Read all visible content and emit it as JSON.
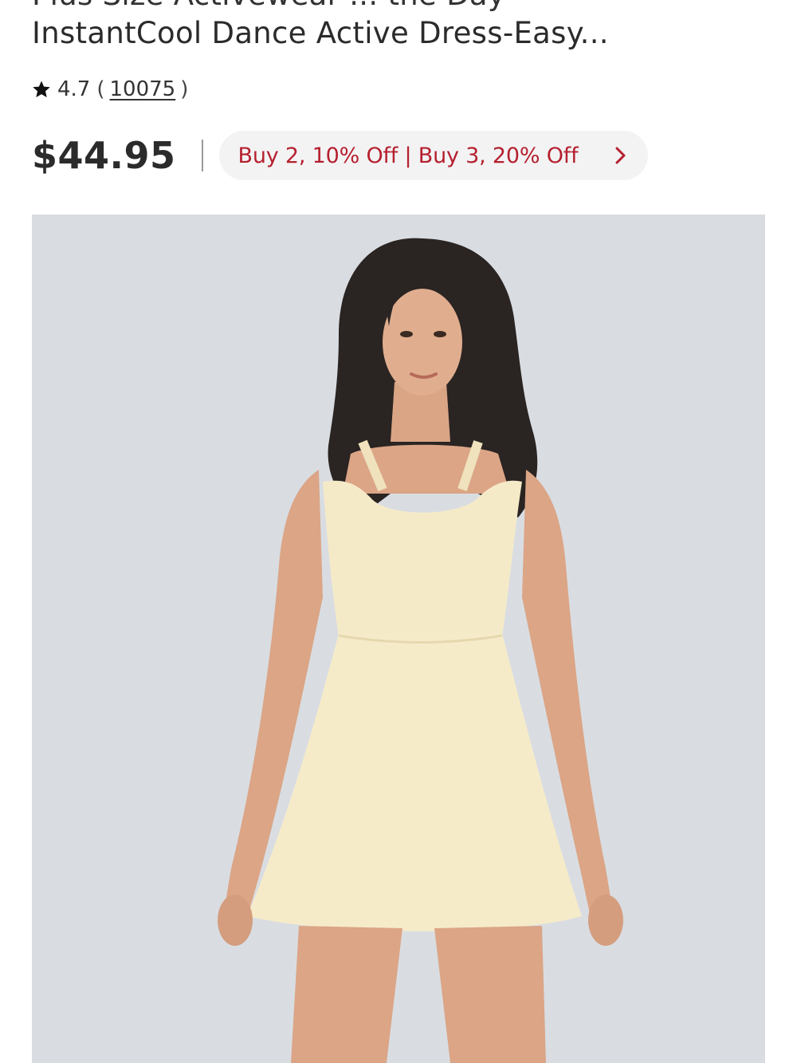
{
  "product": {
    "title_partial_above": "Plus Size Activewear ... the Day",
    "title": "InstantCool Dance Active Dress-Easy...",
    "rating": "4.7",
    "paren_open": "(",
    "review_count": "10075",
    "paren_close": ")",
    "price": "$44.95",
    "promo": "Buy 2, 10% Off | Buy 3, 20% Off"
  },
  "icons": {
    "rating": "star-icon",
    "promo": "chevron-right-icon"
  },
  "colors": {
    "promo_text": "#b5202e",
    "promo_background": "#f3f3f4",
    "image_background": "#d9dde2",
    "dress": "#f6ebc9"
  }
}
